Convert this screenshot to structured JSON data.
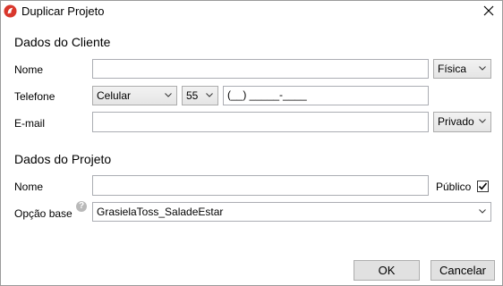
{
  "window": {
    "title": "Duplicar Projeto"
  },
  "cliente": {
    "section_title": "Dados do Cliente",
    "nome_label": "Nome",
    "nome_value": "",
    "pessoa_selected": "Física",
    "telefone_label": "Telefone",
    "tipo_telefone_selected": "Celular",
    "ddi_selected": "55",
    "telefone_value": "(__) _____-____",
    "email_label": "E-mail",
    "email_value": "",
    "privacidade_selected": "Privado"
  },
  "projeto": {
    "section_title": "Dados do Projeto",
    "nome_label": "Nome",
    "nome_value": "",
    "publico_label": "Público",
    "publico_checked": true,
    "opcao_base_label": "Opção base",
    "opcao_base_selected": "GrasielaToss_SaladeEstar",
    "help_glyph": "?"
  },
  "buttons": {
    "ok": "OK",
    "cancel": "Cancelar"
  },
  "colors": {
    "app_icon": "#d9372c"
  }
}
